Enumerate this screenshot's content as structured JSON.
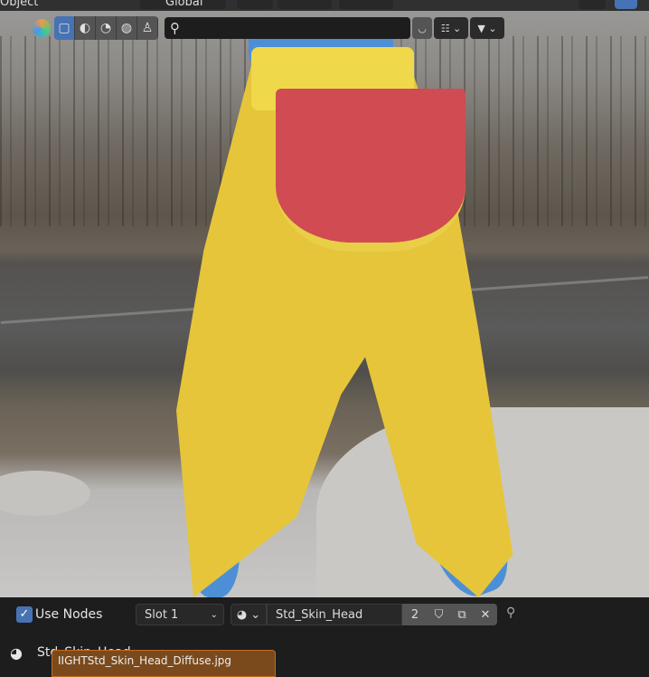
{
  "header": {
    "mode_label": "Object",
    "orientation_label": "Global"
  },
  "outliner_toolbar": {
    "search_placeholder": "",
    "filter_icon": "funnel-icon"
  },
  "material_panel": {
    "use_nodes_label": "Use Nodes",
    "use_nodes_checked": true,
    "slot_label": "Slot 1",
    "material_name": "Std_Skin_Head",
    "user_count": "2",
    "node_material_label": "Std_Skin_Head",
    "texture_popup_label": "IIGHTStd_Skin_Head_Diffuse.jpg"
  },
  "colors": {
    "accent": "#4772b3",
    "popup": "#c26b22",
    "panel": "#1d1d1d"
  }
}
